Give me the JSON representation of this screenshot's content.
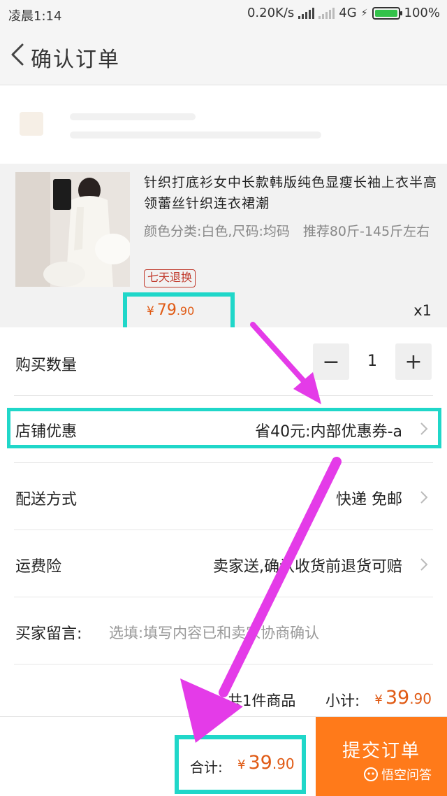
{
  "status_bar": {
    "time": "凌晨1:14",
    "speed": "0.20K/s",
    "network": "4G",
    "battery": "100%",
    "battery_color": "#33c24a"
  },
  "header": {
    "back_icon": "chevron-left-icon",
    "title": "确认订单"
  },
  "product": {
    "title": "针织打底衫女中长款韩版纯色显瘦长袖上衣半高领蕾丝针织连衣裙潮",
    "spec": "颜色分类:白色,尺码:均码　推荐80斤-145斤左右",
    "tag": "七天退换",
    "price_symbol": "¥",
    "price_int": "79",
    "price_dec": ".90",
    "quantity_label": "x1"
  },
  "quantity_row": {
    "label": "购买数量",
    "minus": "−",
    "value": "1",
    "plus": "+"
  },
  "shop_discount": {
    "label": "店铺优惠",
    "value": "省40元:内部优惠券-a"
  },
  "delivery": {
    "label": "配送方式",
    "value": "快递 免邮"
  },
  "insurance": {
    "label": "运费险",
    "value": "卖家送,确认收货前退货可赔"
  },
  "message": {
    "label": "买家留言:",
    "placeholder": "选填:填写内容已和卖家协商确认"
  },
  "subtotal": {
    "count": "共1件商品",
    "label": "小计:",
    "symbol": "¥",
    "int": "39",
    "dec": ".90"
  },
  "bottom_bar": {
    "total_label": "合计:",
    "symbol": "¥",
    "int": "39",
    "dec": ".90",
    "submit_label": "提交订单"
  },
  "watermark": "悟空问答",
  "colors": {
    "accent_orange": "#ff7a1a",
    "price_color": "#e05a14",
    "highlight_teal": "#20d7c9",
    "arrow_magenta": "#e43be8"
  }
}
